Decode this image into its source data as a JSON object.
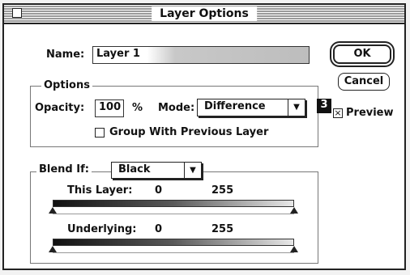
{
  "window": {
    "title": "Layer Options"
  },
  "name": {
    "label": "Name:",
    "value": "Layer 1"
  },
  "options": {
    "group_label": "Options",
    "opacity_label": "Opacity:",
    "opacity_value": "100",
    "percent": "%",
    "mode_label": "Mode:",
    "mode_value": "Difference",
    "group_checkbox_label": "Group With Previous Layer",
    "group_checked": false
  },
  "callout_number": "3",
  "buttons": {
    "ok": "OK",
    "cancel": "Cancel"
  },
  "preview": {
    "label": "Preview",
    "checked": true,
    "mark": "×"
  },
  "blend": {
    "label": "Blend If:",
    "value": "Black",
    "this_layer": {
      "label": "This Layer:",
      "min": "0",
      "max": "255"
    },
    "underlying": {
      "label": "Underlying:",
      "min": "0",
      "max": "255"
    }
  },
  "icons": {
    "popup_arrow": "▼"
  }
}
